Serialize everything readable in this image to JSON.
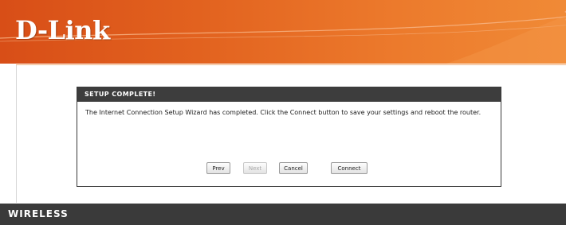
{
  "brand": {
    "logo_text": "D-Link",
    "accent": "#e2621f"
  },
  "setup": {
    "title": "SETUP COMPLETE!",
    "message": "The Internet Connection Setup Wizard has completed. Click the Connect button to save your settings and reboot the router.",
    "buttons": {
      "prev": "Prev",
      "next": "Next",
      "cancel": "Cancel",
      "connect": "Connect"
    }
  },
  "footer": {
    "label": "WIRELESS"
  }
}
